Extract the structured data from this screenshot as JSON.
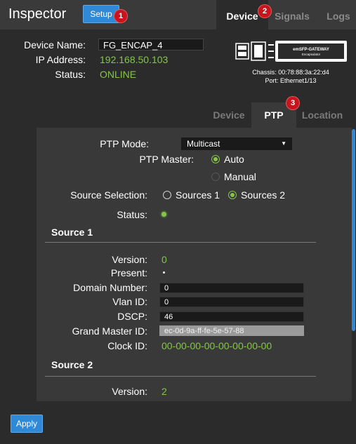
{
  "app": {
    "title": "Inspector",
    "setup_label": "Setup"
  },
  "main_tabs": [
    {
      "label": "Device",
      "active": true
    },
    {
      "label": "Signals",
      "active": false
    },
    {
      "label": "Logs",
      "active": false
    }
  ],
  "badges": [
    "1",
    "2",
    "3"
  ],
  "device": {
    "name_label": "Device Name:",
    "name_value": "FG_ENCAP_4",
    "ip_label": "IP Address:",
    "ip_value": "192.168.50.103",
    "status_label": "Status:",
    "status_value": "ONLINE",
    "module_brand": "emSFP-GATEWAY",
    "module_type": "Encapsulator",
    "chassis": "Chassis: 00:78:88:3a:22:d4",
    "port": "Port: Ethernet1/13"
  },
  "sub_tabs": [
    {
      "label": "Device",
      "active": false
    },
    {
      "label": "PTP",
      "active": true
    },
    {
      "label": "Location",
      "active": false
    }
  ],
  "ptp": {
    "mode_label": "PTP Mode:",
    "mode_value": "Multicast",
    "master_label": "PTP Master:",
    "master_options": [
      {
        "label": "Auto",
        "checked": true
      },
      {
        "label": "Manual",
        "checked": false
      }
    ],
    "source_sel_label": "Source Selection:",
    "source_options": [
      {
        "label": "Sources 1",
        "checked": false
      },
      {
        "label": "Sources 2",
        "checked": true
      }
    ],
    "status_label": "Status:"
  },
  "source1": {
    "title": "Source 1",
    "version_label": "Version:",
    "version_value": "0",
    "present_label": "Present:",
    "domain_label": "Domain Number:",
    "domain_value": "0",
    "vlan_label": "Vlan ID:",
    "vlan_value": "0",
    "dscp_label": "DSCP:",
    "dscp_value": "46",
    "gm_label": "Grand Master ID:",
    "gm_value": "ec-0d-9a-ff-fe-5e-57-88",
    "clock_label": "Clock ID:",
    "clock_value": "00-00-00-00-00-00-00-00"
  },
  "source2": {
    "title": "Source 2",
    "version_label": "Version:",
    "version_value": "2"
  },
  "apply_label": "Apply",
  "colors": {
    "accent": "#2f89d6",
    "ok": "#84c54a",
    "badge": "#c8141e"
  }
}
